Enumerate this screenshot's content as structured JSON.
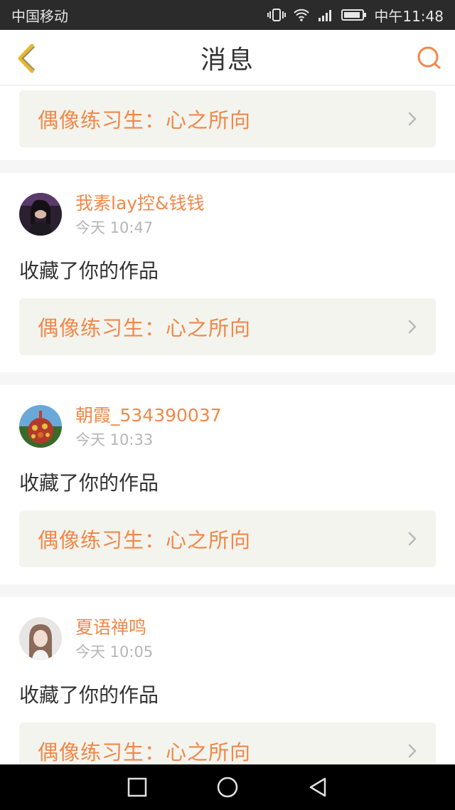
{
  "status": {
    "carrier": "中国移动",
    "time": "中午11:48"
  },
  "header": {
    "title": "消息"
  },
  "work_title": "偶像练习生：心之所向",
  "items": [
    {
      "username": "我素lay控&钱钱",
      "time": "今天 10:47",
      "action": "收藏了你的作品",
      "work": "偶像练习生：心之所向"
    },
    {
      "username": "朝霞_534390037",
      "time": "今天 10:33",
      "action": "收藏了你的作品",
      "work": "偶像练习生：心之所向"
    },
    {
      "username": "夏语禅鸣",
      "time": "今天 10:05",
      "action": "收藏了你的作品",
      "work": "偶像练习生：心之所向"
    }
  ],
  "colors": {
    "accent": "#f0884a",
    "link_bg": "#f4f4ee",
    "status_bar": "#2b2b2b"
  }
}
